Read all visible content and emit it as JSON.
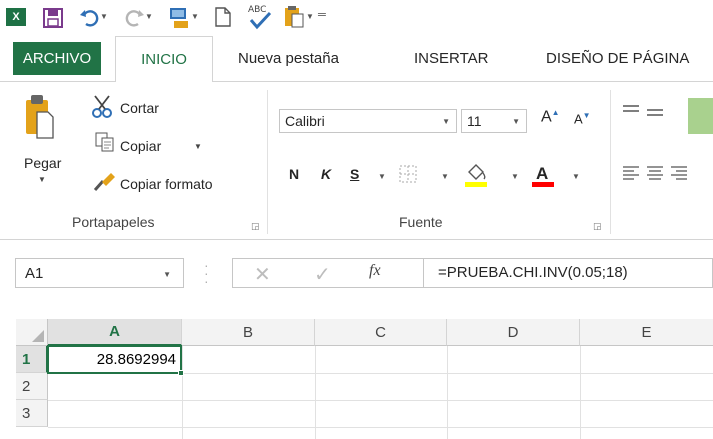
{
  "qat": {
    "app_icon": "excel-icon",
    "icons": [
      "save-icon",
      "undo-icon",
      "redo-icon",
      "copy-screen-icon",
      "new-document-icon",
      "spellcheck-icon",
      "paste-icon",
      "customize-qat-icon"
    ],
    "spell_text": "ABC"
  },
  "tabs": {
    "archivo": "ARCHIVO",
    "inicio": "INICIO",
    "nueva": "Nueva pestaña",
    "insertar": "INSERTAR",
    "diseno": "DISEÑO DE PÁGINA"
  },
  "ribbon": {
    "clipboard": {
      "paste_label": "Pegar",
      "cut_label": "Cortar",
      "copy_label": "Copiar",
      "format_painter_label": "Copiar formato",
      "group_label": "Portapapeles"
    },
    "font": {
      "font_name": "Calibri",
      "font_size": "11",
      "grow_label": "A",
      "shrink_label": "A",
      "bold_label": "N",
      "italic_label": "K",
      "underline_label": "S",
      "font_color_label": "A",
      "group_label": "Fuente"
    },
    "colors": {
      "accent": "#217346",
      "fill_color": "#ffff00",
      "font_color": "#ff0000"
    }
  },
  "formula_bar": {
    "name_box": "A1",
    "fx_label": "fx",
    "formula": "=PRUEBA.CHI.INV(0.05;18)"
  },
  "grid": {
    "columns": [
      "A",
      "B",
      "C",
      "D",
      "E"
    ],
    "rows": [
      "1",
      "2",
      "3"
    ],
    "cells": {
      "A1": "28.8692994"
    }
  }
}
